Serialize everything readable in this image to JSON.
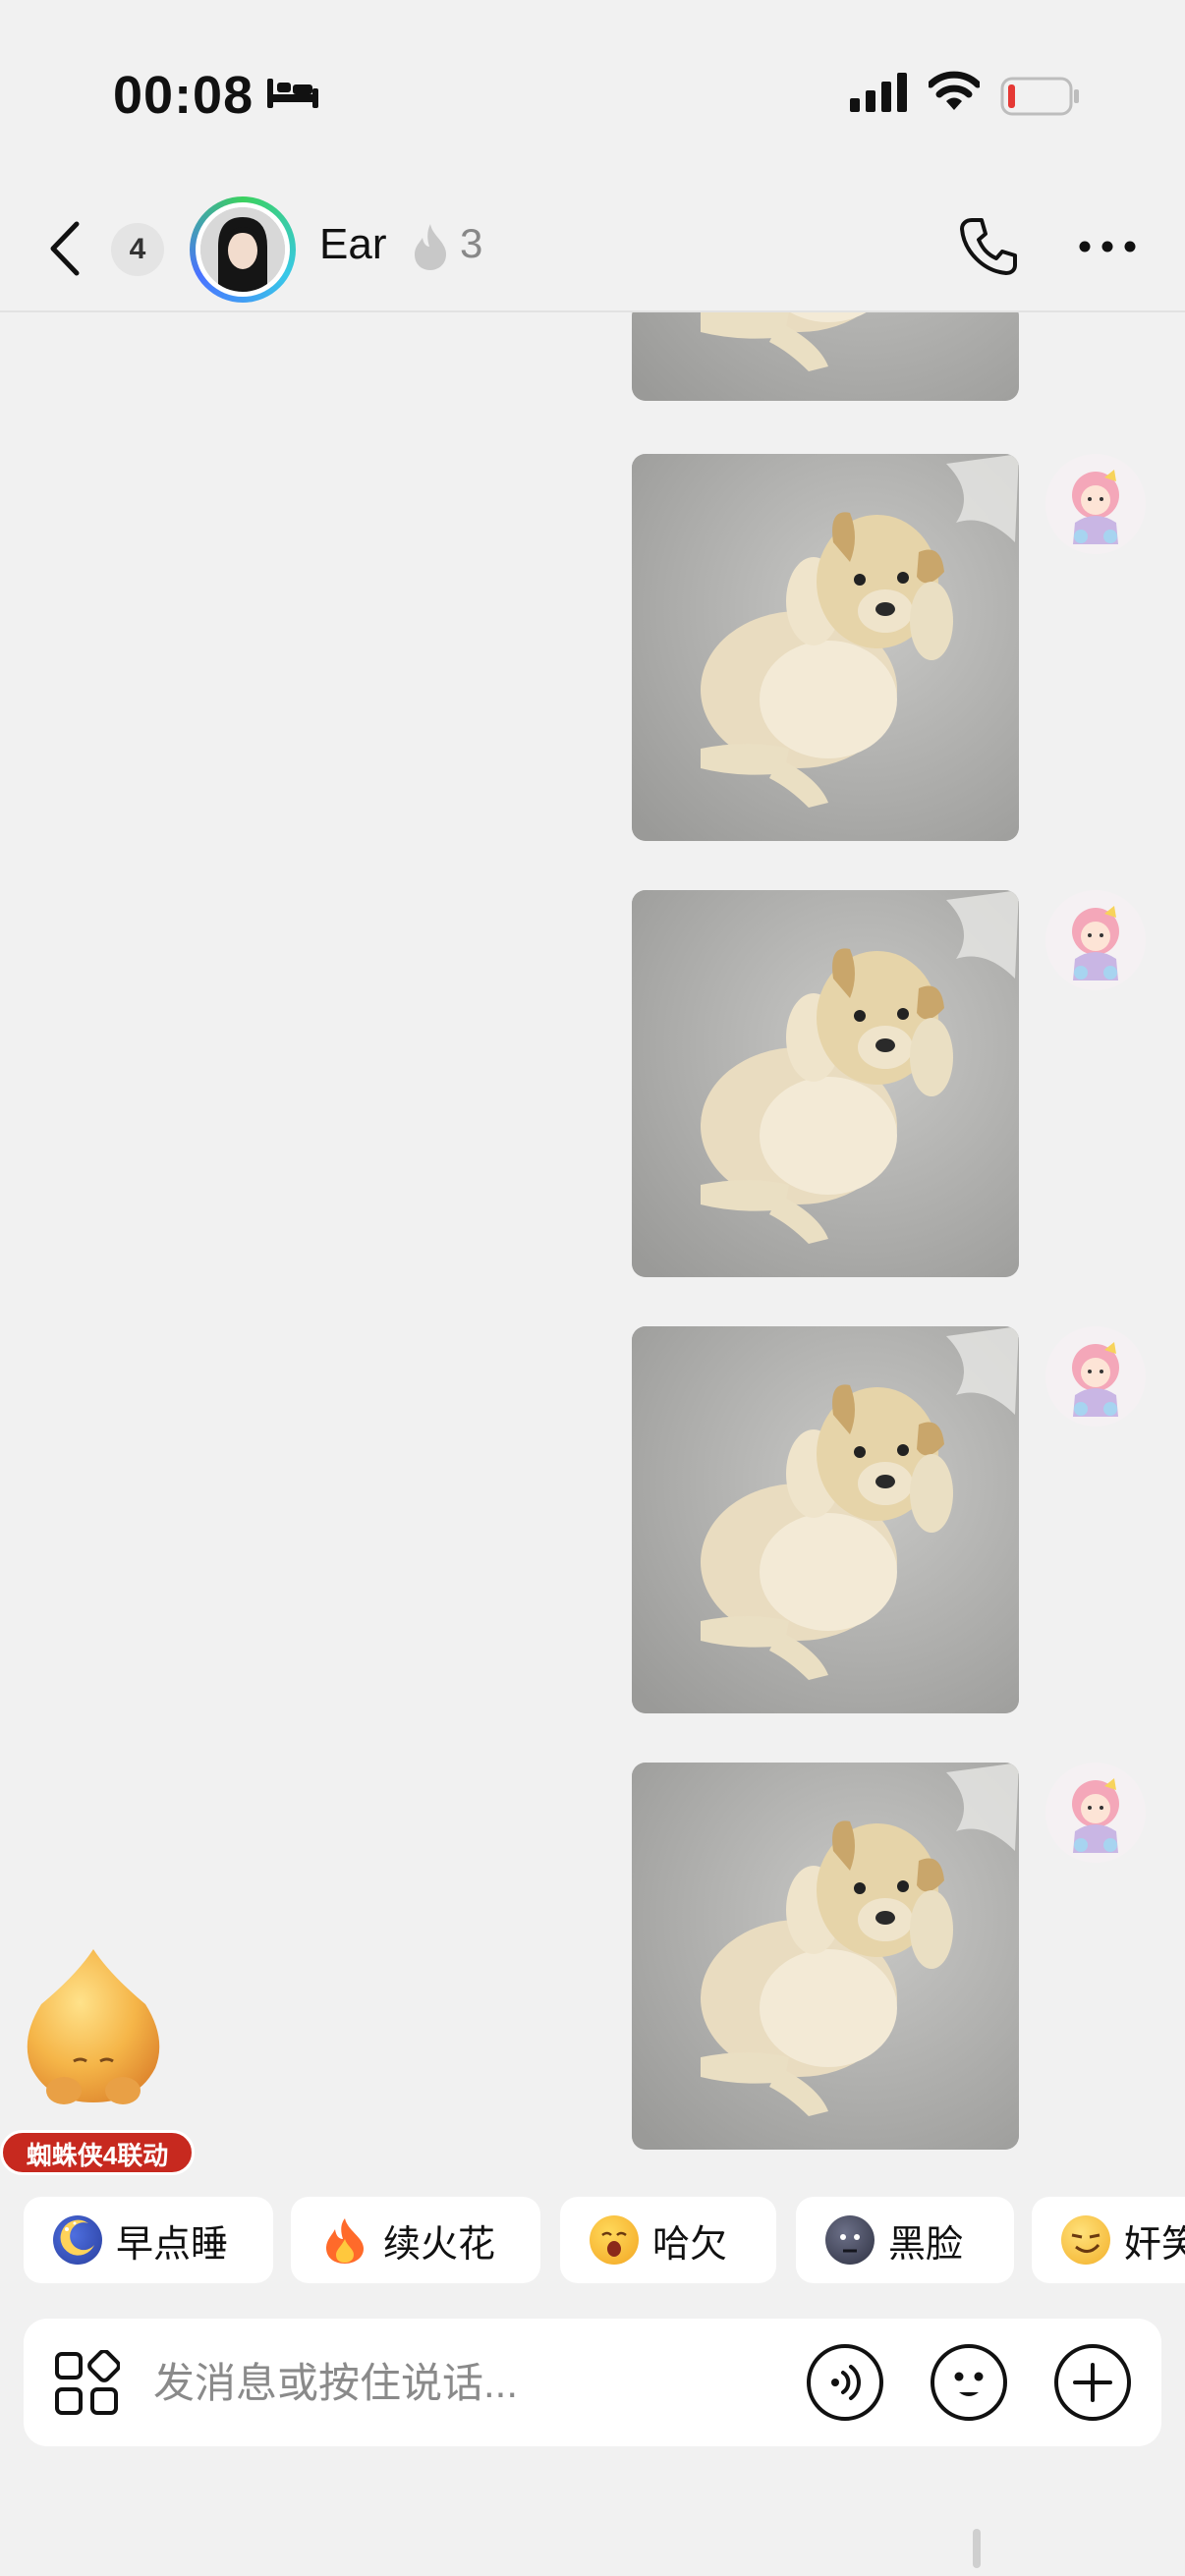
{
  "status_bar": {
    "time": "00:08",
    "focus_icon": "bed-icon",
    "signal_icon": "cellular-signal-icon",
    "wifi_icon": "wifi-icon",
    "battery_icon": "battery-low-icon",
    "battery_color": "#e53935"
  },
  "header": {
    "back_icon": "chevron-left-icon",
    "unread_count": "4",
    "contact_name": "Ear",
    "streak_icon": "flame-icon",
    "streak_count": "3",
    "call_icon": "phone-icon",
    "more_icon": "more-dots-icon"
  },
  "messages": [
    {
      "type": "image",
      "sender": "me",
      "partial": true,
      "image": "puppy-photo"
    },
    {
      "type": "image",
      "sender": "me",
      "image": "puppy-photo"
    },
    {
      "type": "image",
      "sender": "me",
      "image": "puppy-photo"
    },
    {
      "type": "image",
      "sender": "me",
      "image": "puppy-photo"
    },
    {
      "type": "image",
      "sender": "me",
      "image": "puppy-photo"
    }
  ],
  "mascot": {
    "icon": "peach-mascot-icon",
    "tag": "蜘蛛侠4联动",
    "tag_color": "#c7291f"
  },
  "quick_replies": [
    {
      "icon": "sleepy-moon-emoji",
      "label": "早点睡"
    },
    {
      "icon": "fire-emoji",
      "label": "续火花"
    },
    {
      "icon": "yawn-emoji",
      "label": "哈欠"
    },
    {
      "icon": "dark-face-emoji",
      "label": "黑脸"
    },
    {
      "icon": "smirk-emoji",
      "label": "奸笑"
    }
  ],
  "input_bar": {
    "apps_icon": "apps-grid-icon",
    "placeholder": "发消息或按住说话...",
    "voice_icon": "voice-waves-icon",
    "emoji_icon": "smiley-icon",
    "plus_icon": "plus-icon"
  },
  "colors": {
    "background": "#f1f1f1",
    "bubble_bg": "#ffffff",
    "accent_ring": "#38c8e8"
  }
}
